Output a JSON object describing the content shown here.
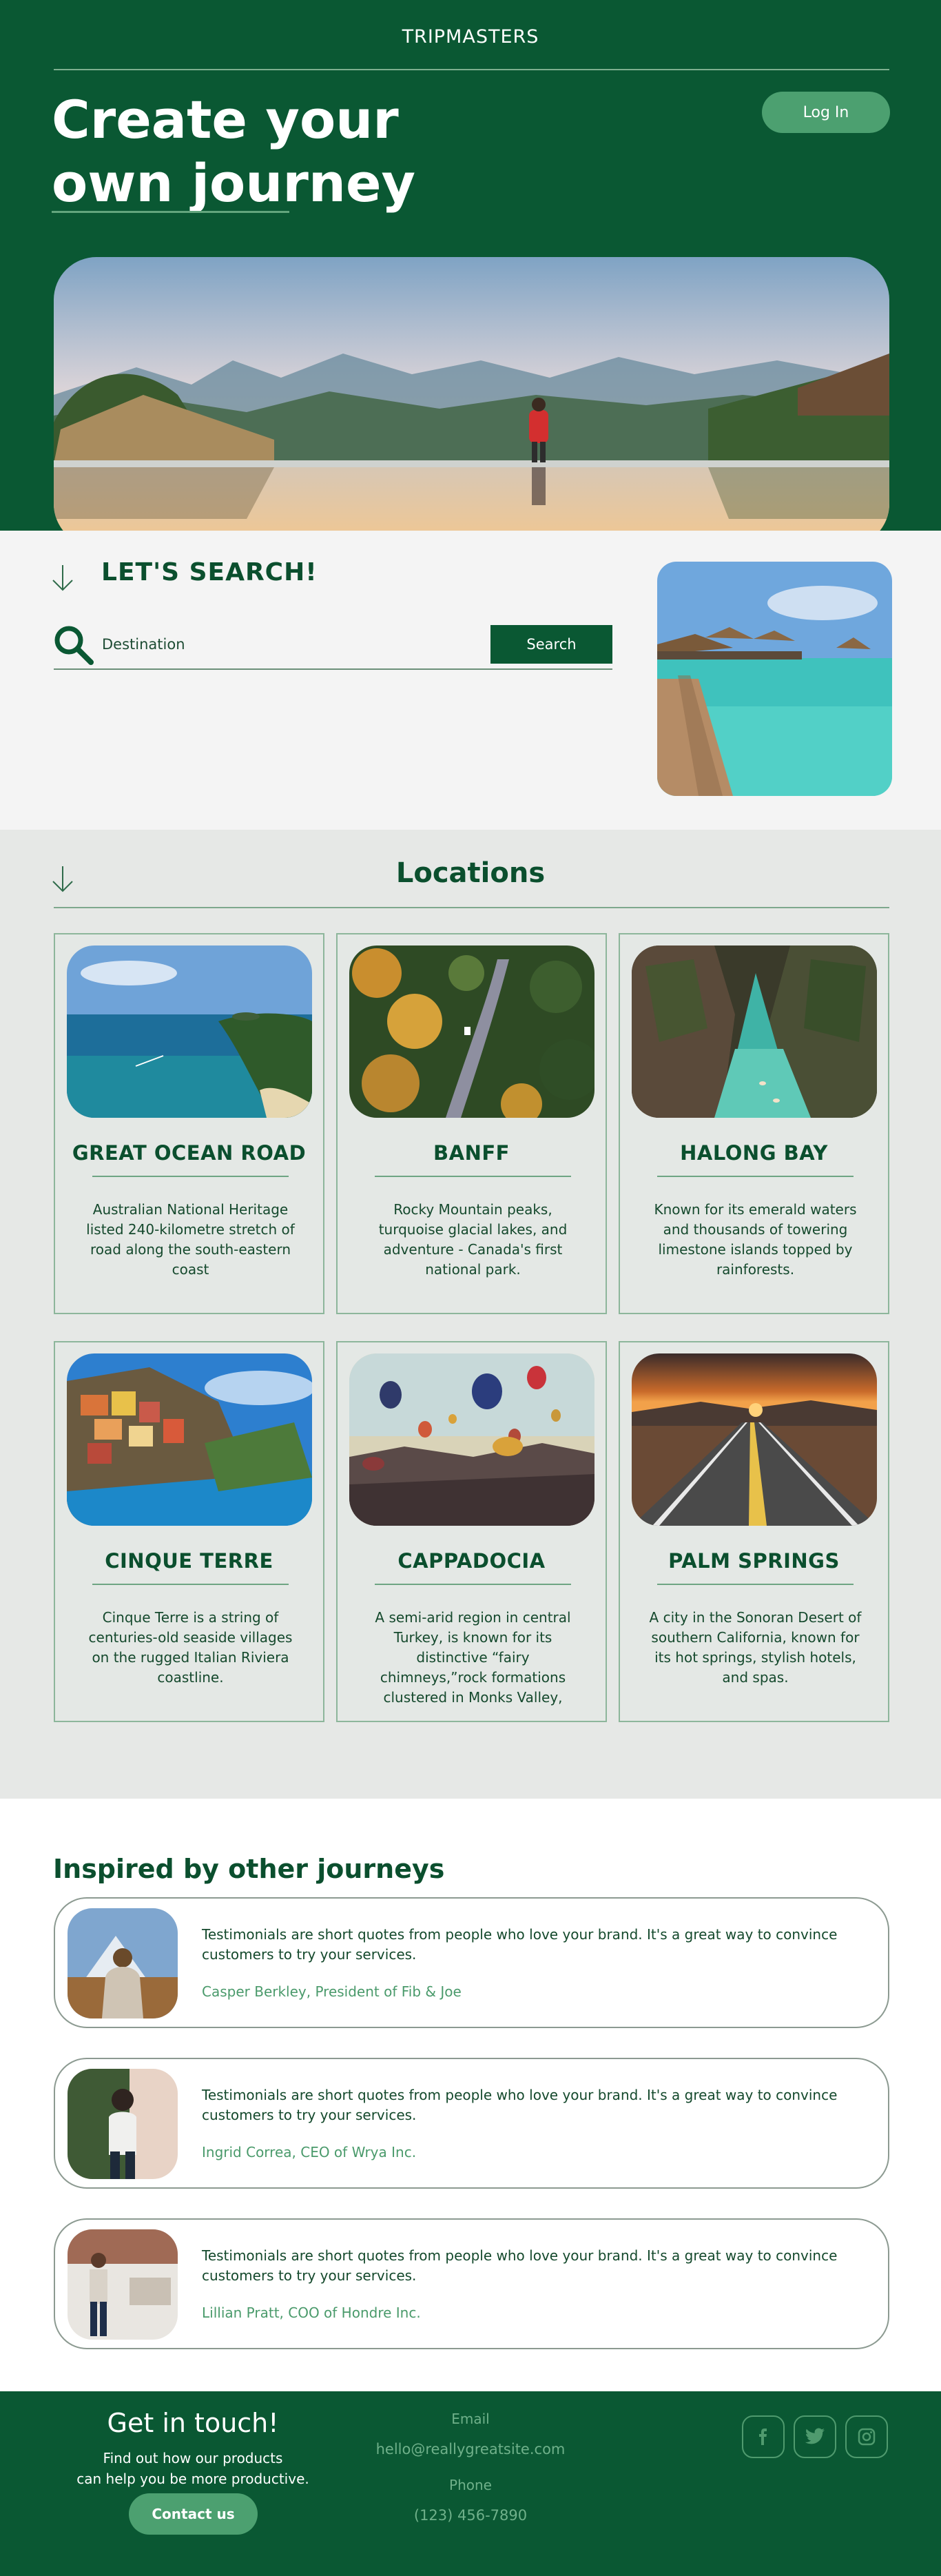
{
  "header": {
    "brand": "TRIPMASTERS",
    "title": "Create your own journey",
    "login_label": "Log In"
  },
  "search": {
    "title": "LET'S SEARCH!",
    "placeholder": "Destination",
    "button_label": "Search"
  },
  "locations": {
    "title": "Locations",
    "items": [
      {
        "name": "GREAT OCEAN ROAD",
        "description": "Australian National Heritage listed 240-kilometre stretch of road along the south-eastern coast"
      },
      {
        "name": "BANFF",
        "description": "Rocky Mountain peaks, turquoise glacial lakes, and adventure - Canada's first national park."
      },
      {
        "name": "HALONG BAY",
        "description": "Known for its emerald waters and thousands of towering limestone islands topped by rainforests."
      },
      {
        "name": "CINQUE TERRE",
        "description": "Cinque Terre is a string of centuries-old seaside villages on the rugged Italian Riviera coastline."
      },
      {
        "name": "CAPPADOCIA",
        "description": "A semi-arid region in central Turkey, is known for its distinctive “fairy chimneys,”rock formations clustered in Monks Valley,"
      },
      {
        "name": "PALM SPRINGS",
        "description": "A  city in the Sonoran Desert of southern California, known for its hot springs, stylish hotels, and spas."
      }
    ]
  },
  "testimonials": {
    "title": "Inspired by other journeys",
    "items": [
      {
        "quote": "Testimonials are short quotes from people who love your brand. It's a great way to convince customers to try your services.",
        "author": "Casper Berkley, President of Fib & Joe"
      },
      {
        "quote": "Testimonials are short quotes from people who love your brand. It's a great way to convince customers to try your services.",
        "author": "Ingrid Correa, CEO of Wrya Inc."
      },
      {
        "quote": "Testimonials are short quotes from people who love your brand. It's a great way to convince customers to try your services.",
        "author": "Lillian Pratt, COO of Hondre Inc."
      }
    ]
  },
  "footer": {
    "title": "Get in touch!",
    "subtitle_line1": "Find out how our products",
    "subtitle_line2": "can help you be more productive.",
    "contact_button": "Contact us",
    "email_label": "Email",
    "email_value": "hello@reallygreatsite.com",
    "phone_label": "Phone",
    "phone_value": "(123) 456-7890",
    "social_icons": [
      "facebook-icon",
      "twitter-icon",
      "instagram-icon"
    ]
  },
  "colors": {
    "brand_green": "#0a5833",
    "accent_green": "#4ca070",
    "section_gray": "#e6e8e6"
  }
}
